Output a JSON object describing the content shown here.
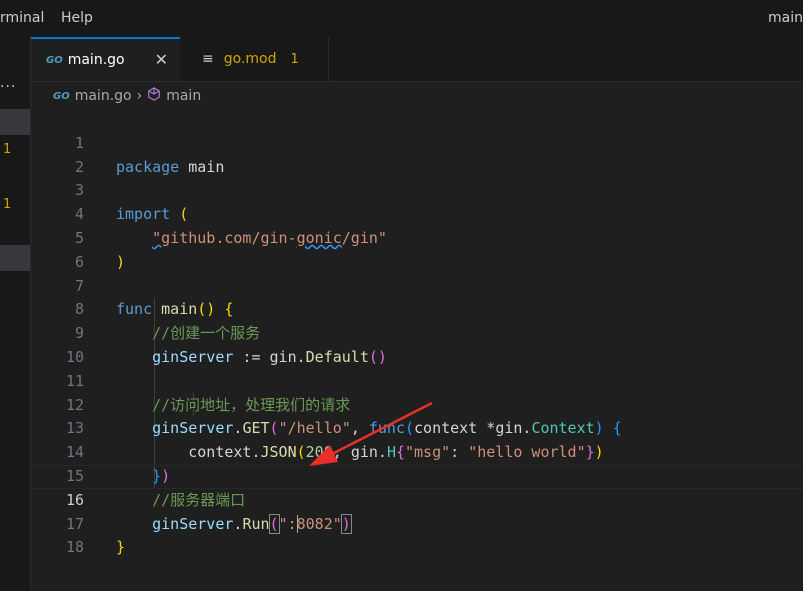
{
  "menubar": {
    "items": [
      "rminal",
      "Help"
    ],
    "title": "main"
  },
  "activity": {
    "dots": "···",
    "badges": [
      "1",
      "1"
    ]
  },
  "tabs": [
    {
      "icon": "go-file-icon",
      "logo": "GO",
      "label": "main.go",
      "close": "✕",
      "active": true
    },
    {
      "icon": "gomod-file-icon",
      "label": "go.mod",
      "count": "1",
      "active": false
    }
  ],
  "breadcrumb": {
    "logo": "GO",
    "file": "main.go",
    "sep": "›",
    "symbol": "main"
  },
  "editor": {
    "current_line": 16,
    "lines": [
      "1",
      "2",
      "3",
      "4",
      "5",
      "6",
      "7",
      "8",
      "9",
      "10",
      "11",
      "12",
      "13",
      "14",
      "15",
      "16",
      "17",
      "18"
    ],
    "code": {
      "pkg_kw": "package",
      "pkg_name": "main",
      "import_kw": "import",
      "paren_open": "(",
      "import_q1": "\"",
      "import_path_a": "github.com/gin-",
      "import_path_b": "gonic",
      "import_path_c": "/gin",
      "import_q2": "\"",
      "paren_close": ")",
      "func_kw": "func",
      "main_fn": "main",
      "parens": "()",
      "brace_open": "{",
      "comment1": "//创建一个服务",
      "gs1": "ginServer",
      "assign": " := ",
      "gin1": "gin",
      "dot1": ".",
      "default_fn": "Default",
      "default_parens": "()",
      "comment2": "//访问地址，处理我们的请求",
      "gs2": "ginServer",
      "dot2": ".",
      "get_fn": "GET",
      "get_paren": "(",
      "route": "\"/hello\"",
      "comma1": ", ",
      "func2": "func",
      "fparen": "(",
      "ctx_param": "context",
      "star": " *",
      "gin2": "gin",
      "dot3": ".",
      "ctx_type": "Context",
      "fparen_close": ")",
      "brace2": " {",
      "ctx": "context",
      "dot4": ".",
      "json_fn": "JSON",
      "json_paren": "(",
      "status": "200",
      "comma2": ", ",
      "gin3": "gin",
      "dot5": ".",
      "h_type": "H",
      "h_brace": "{",
      "key": "\"msg\"",
      "colon": ": ",
      "val": "\"hello world\"",
      "h_brace_close": "}",
      "json_paren_close": ")",
      "close_brace2": "}",
      "close_paren2": ")",
      "comment3": "//服务器端口",
      "gs3": "ginServer",
      "dot6": ".",
      "run_fn": "Run",
      "run_paren": "(",
      "port_a": "\":",
      "port_b": "8082\"",
      "run_paren_close": ")",
      "brace_close": "}"
    }
  },
  "colors": {
    "accent": "#0078d4",
    "warning": "#cca700",
    "annotation_arrow": "#e8302a"
  }
}
